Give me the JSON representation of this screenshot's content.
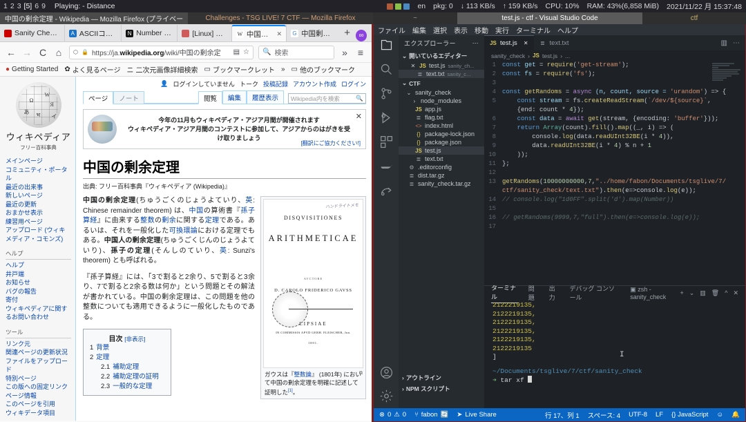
{
  "wm_bar": {
    "workspaces": [
      "1",
      "2",
      "3",
      "[5]",
      "6",
      "9"
    ],
    "active_workspace": "[5]",
    "playing": "Playing: - Distance",
    "keyboard_layout": "en",
    "pkg": "pkg: 0",
    "download": "↓ 113 KB/s",
    "upload": "↑ 159 KB/s",
    "cpu": "CPU: 10%",
    "ram": "RAM: 43%(6,858 MiB)",
    "clock": "2021/11/22 月 15:37:48"
  },
  "window_titles": {
    "firefox_private": "中国の剰余定理 - Wikipedia — Mozilla Firefox (プライベー",
    "firefox_ctf": "Challenges - TSG LIVE! 7 CTF — Mozilla Firefox",
    "middle": "~",
    "vscode": "test.js - ctf - Visual Studio Code",
    "ctf": "ctf"
  },
  "firefox": {
    "tabs": [
      {
        "label": "Sanity Checker",
        "icon": "",
        "icon_color": "#cc0000",
        "active": false
      },
      {
        "label": "ASCIIコード",
        "icon": "A",
        "icon_color": "#1a73c8",
        "active": false
      },
      {
        "label": "Number - Ja",
        "icon": "N",
        "icon_color": "#111111",
        "active": false
      },
      {
        "label": "[Linux] バイ",
        "icon": "T",
        "icon_color": "#d05a5a",
        "active": false
      },
      {
        "label": "中国の剰",
        "icon": "W",
        "icon_color": "#ffffff",
        "active": true
      },
      {
        "label": "中国剰余定",
        "icon": "G",
        "icon_color": "#4285f4",
        "active": false
      }
    ],
    "new_tab_label": "+",
    "pocket_label": "∞",
    "nav": {
      "back": "←",
      "forward": "→",
      "reload": "C",
      "home": "⌂",
      "shield": "🛡",
      "lock": "🔒",
      "url_prefix": "https://ja.",
      "url_domain": "wikipedia.org",
      "url_path": "/wiki/中国の剰余定",
      "reader_icon": "▤",
      "bookmark_icon": "☆",
      "search_placeholder": "検索",
      "overflow": "»",
      "menu": "≡"
    },
    "bookmarks": [
      {
        "label": "Getting Started",
        "icon": "●"
      },
      {
        "label": "よく見るページ",
        "icon": "✿"
      },
      {
        "label": "二次元画像詳細検索",
        "icon": "ニ"
      },
      {
        "label": "ブックマークレット",
        "icon": "▭"
      },
      {
        "label": "»",
        "icon": ""
      },
      {
        "label": "他のブックマーク",
        "icon": "▭"
      }
    ]
  },
  "wikipedia": {
    "wordmark": "ウィキペディア",
    "tagline": "フリー百科事典",
    "sidebar_sections": [
      {
        "heading": "",
        "links": [
          "メインページ",
          "コミュニティ・ポータル",
          "最近の出来事",
          "新しいページ",
          "最近の更新",
          "おまかせ表示",
          "練習用ページ",
          "アップロード (ウィキメディア・コモンズ)"
        ]
      },
      {
        "heading": "ヘルプ",
        "links": [
          "ヘルプ",
          "井戸端",
          "お知らせ",
          "バグの報告",
          "寄付",
          "ウィキペディアに関するお問い合わせ"
        ]
      },
      {
        "heading": "ツール",
        "links": [
          "リンク元",
          "関連ページの更新状況",
          "ファイルをアップロード",
          "特別ページ",
          "この版への固定リンク",
          "ページ情報",
          "このページを引用",
          "ウィキデータ項目"
        ]
      }
    ],
    "userbar": {
      "not_logged_in": "ログインしていません",
      "items": [
        "トーク",
        "投稿記録",
        "アカウント作成",
        "ログイン"
      ]
    },
    "page_tabs": [
      "ページ",
      "ノート"
    ],
    "view_tabs": [
      "閲覧",
      "編集",
      "履歴表示"
    ],
    "search_placeholder": "Wikipedia内を検索",
    "banner": {
      "line1": "今年の11月もウィキペディア・アジア月間が開催されます",
      "line2": "ウィキペディア・アジア月間のコンテストに参加して、アジアからのはがきを受け取りましょう",
      "translate": "[翻訳にご協力ください!]",
      "close": "✕"
    },
    "title": "中国の剰余定理",
    "subtitle": "出典: フリー百科事典『ウィキペディア (Wikipedia)』",
    "paragraph1_parts": [
      {
        "t": "中国の剰余定理",
        "s": "bld"
      },
      {
        "t": "(ちゅうごくのじょうよていり、",
        "s": ""
      },
      {
        "t": "英",
        "s": "lnk"
      },
      {
        "t": ": Chinese remainder theorem) は、",
        "s": ""
      },
      {
        "t": "中国",
        "s": "lnk"
      },
      {
        "t": "の算術書『",
        "s": ""
      },
      {
        "t": "孫子算経",
        "s": "lnk"
      },
      {
        "t": "』に由来する",
        "s": ""
      },
      {
        "t": "整数",
        "s": "lnk"
      },
      {
        "t": "の",
        "s": ""
      },
      {
        "t": "剰余",
        "s": "lnk"
      },
      {
        "t": "に関する",
        "s": ""
      },
      {
        "t": "定理",
        "s": "lnk"
      },
      {
        "t": "である。あるいは、それを一般化した",
        "s": ""
      },
      {
        "t": "可換環論",
        "s": "lnk"
      },
      {
        "t": "における定理でもある。",
        "s": ""
      },
      {
        "t": "中国人の剰余定理",
        "s": "bld"
      },
      {
        "t": "(ちゅうごくじんのじょうよていり)、",
        "s": ""
      },
      {
        "t": "孫子の定理",
        "s": "bld"
      },
      {
        "t": "(そんしのていり、",
        "s": ""
      },
      {
        "t": "英",
        "s": "lnk"
      },
      {
        "t": ": Sunzi's theorem) とも呼ばれる。",
        "s": ""
      }
    ],
    "paragraph2": "『孫子算経』には、「3で割ると2余り、5で割ると3余り、7で割ると2余る数は何か」という問題とその解法が書かれている。中国の剰余定理は、この問題を他の整数についても適用できるように一般化したものである。",
    "toc": {
      "heading": "目次",
      "toggle": "[非表示]",
      "items": [
        {
          "num": "1",
          "label": "背景",
          "level": 1
        },
        {
          "num": "2",
          "label": "定理",
          "level": 1
        },
        {
          "num": "2.1",
          "label": "補助定理",
          "level": 2
        },
        {
          "num": "2.2",
          "label": "補助定理の証明",
          "level": 2
        },
        {
          "num": "2.3",
          "label": "一般的な定理",
          "level": 2
        }
      ]
    },
    "figure": {
      "hand_note": "ハンドライトメモ",
      "title_line1": "DISQVISITIONES",
      "title_line2": "ARITHMETICAE",
      "auctore": "AVCTORE",
      "author": "D. CAROLO FRIDERICO GAVSS",
      "city": "LIPSIAE",
      "imprint": "IN COMMISSIS APVD GERH. FLEISCHER, Jun.",
      "year": "1801.",
      "caption_pre": "ガウスは『",
      "caption_link": "整数論",
      "caption_post": "』 (1801年) において中国の剰余定理を明確に記述して証明した",
      "caption_ref": "[1]",
      "caption_end": "。",
      "enlarge": "⧉"
    }
  },
  "vscode": {
    "menu": [
      "ファイル",
      "編集",
      "選択",
      "表示",
      "移動",
      "実行",
      "ターミナル",
      "ヘルプ"
    ],
    "activity_icons": [
      "explorer-icon",
      "search-icon",
      "source-control-icon",
      "run-debug-icon",
      "extensions-icon",
      "docker-icon",
      "live-share-icon"
    ],
    "activity_bottom_icons": [
      "account-icon",
      "settings-gear-icon"
    ],
    "sidebar": {
      "title": "エクスプローラー",
      "more": "⋯",
      "open_editors": {
        "label": "開いているエディター",
        "items": [
          {
            "name": "test.js",
            "desc": "sanity_ch...",
            "icon": "js",
            "close": "✕",
            "selected": false
          },
          {
            "name": "text.txt",
            "desc": "sanity_c...",
            "icon": "txt",
            "close": "",
            "selected": true
          }
        ]
      },
      "workspace": {
        "label": "CTF",
        "items": [
          {
            "name": "sanity_check",
            "icon": "folder",
            "indent": 1,
            "chevron": "⌄",
            "selected": false
          },
          {
            "name": "node_modules",
            "icon": "folder",
            "indent": 2,
            "chevron": "›",
            "selected": false
          },
          {
            "name": "app.js",
            "icon": "js",
            "indent": 2,
            "chevron": "",
            "selected": false
          },
          {
            "name": "flag.txt",
            "icon": "txt",
            "indent": 2,
            "chevron": "",
            "selected": false
          },
          {
            "name": "index.html",
            "icon": "html",
            "indent": 2,
            "chevron": "",
            "selected": false
          },
          {
            "name": "package-lock.json",
            "icon": "json",
            "indent": 2,
            "chevron": "",
            "selected": false
          },
          {
            "name": "package.json",
            "icon": "json",
            "indent": 2,
            "chevron": "",
            "selected": false
          },
          {
            "name": "test.js",
            "icon": "js",
            "indent": 2,
            "chevron": "",
            "selected": true
          },
          {
            "name": "text.txt",
            "icon": "txt",
            "indent": 2,
            "chevron": "",
            "selected": false
          },
          {
            "name": ".editorconfig",
            "icon": "gear",
            "indent": 1,
            "chevron": "",
            "selected": false
          },
          {
            "name": "dist.tar.gz",
            "icon": "txt",
            "indent": 1,
            "chevron": "",
            "selected": false
          },
          {
            "name": "sanity_check.tar.gz",
            "icon": "txt",
            "indent": 1,
            "chevron": "",
            "selected": false
          }
        ]
      },
      "outline_label": "アウトライン",
      "npm_label": "NPM スクリプト"
    },
    "editor_tabs": [
      {
        "label": "test.js",
        "icon": "js",
        "active": true,
        "close": "✕"
      },
      {
        "label": "text.txt",
        "icon": "txt",
        "active": false,
        "close": ""
      }
    ],
    "editor_actions": [
      "split-editor-icon",
      "more-actions-icon"
    ],
    "breadcrumb": [
      "sanity_check",
      "test.js",
      "..."
    ],
    "code_lines": [
      {
        "n": "1",
        "tokens": [
          {
            "t": "const ",
            "s": "k"
          },
          {
            "t": "get ",
            "s": "var"
          },
          {
            "t": "= ",
            "s": "pl"
          },
          {
            "t": "require",
            "s": "fn"
          },
          {
            "t": "(",
            "s": "pl"
          },
          {
            "t": "'get-stream'",
            "s": "str"
          },
          {
            "t": ");",
            "s": "pl"
          }
        ]
      },
      {
        "n": "2",
        "tokens": [
          {
            "t": "const ",
            "s": "k"
          },
          {
            "t": "fs ",
            "s": "var"
          },
          {
            "t": "= ",
            "s": "pl"
          },
          {
            "t": "require",
            "s": "fn"
          },
          {
            "t": "(",
            "s": "pl"
          },
          {
            "t": "'fs'",
            "s": "str"
          },
          {
            "t": ");",
            "s": "pl"
          }
        ]
      },
      {
        "n": "3",
        "tokens": []
      },
      {
        "n": "4",
        "tokens": [
          {
            "t": "const ",
            "s": "k"
          },
          {
            "t": "getRandoms ",
            "s": "fn"
          },
          {
            "t": "= ",
            "s": "pl"
          },
          {
            "t": "async ",
            "s": "kw2"
          },
          {
            "t": "(n, count, source = ",
            "s": "var"
          },
          {
            "t": "'urandom'",
            "s": "str"
          },
          {
            "t": ") => {",
            "s": "pl"
          }
        ]
      },
      {
        "n": "5",
        "tokens": [
          {
            "t": "    const ",
            "s": "k"
          },
          {
            "t": "stream ",
            "s": "var"
          },
          {
            "t": "= fs.",
            "s": "pl"
          },
          {
            "t": "createReadStream",
            "s": "fn"
          },
          {
            "t": "(",
            "s": "pl"
          },
          {
            "t": "`/dev/${source}`",
            "s": "str"
          },
          {
            "t": ",",
            "s": "pl"
          }
        ]
      },
      {
        "n": "",
        "tokens": [
          {
            "t": "    {end: count * ",
            "s": "pl"
          },
          {
            "t": "4",
            "s": "num"
          },
          {
            "t": "});",
            "s": "pl"
          }
        ]
      },
      {
        "n": "6",
        "tokens": [
          {
            "t": "    const ",
            "s": "k"
          },
          {
            "t": "data ",
            "s": "var"
          },
          {
            "t": "= ",
            "s": "pl"
          },
          {
            "t": "await ",
            "s": "kw2"
          },
          {
            "t": "get",
            "s": "fn"
          },
          {
            "t": "(stream, {encoding: ",
            "s": "pl"
          },
          {
            "t": "'buffer'",
            "s": "str"
          },
          {
            "t": "}));",
            "s": "pl"
          }
        ]
      },
      {
        "n": "7",
        "tokens": [
          {
            "t": "    return ",
            "s": "k"
          },
          {
            "t": "Array",
            "s": "cls"
          },
          {
            "t": "(count).",
            "s": "pl"
          },
          {
            "t": "fill",
            "s": "fn"
          },
          {
            "t": "().",
            "s": "pl"
          },
          {
            "t": "map",
            "s": "fn"
          },
          {
            "t": "((_, i) => (",
            "s": "pl"
          }
        ]
      },
      {
        "n": "8",
        "tokens": [
          {
            "t": "        console.",
            "s": "pl"
          },
          {
            "t": "log",
            "s": "fn"
          },
          {
            "t": "(data.",
            "s": "pl"
          },
          {
            "t": "readUInt32BE",
            "s": "fn"
          },
          {
            "t": "(i * ",
            "s": "pl"
          },
          {
            "t": "4",
            "s": "num"
          },
          {
            "t": ")),",
            "s": "pl"
          }
        ]
      },
      {
        "n": "9",
        "tokens": [
          {
            "t": "        data.",
            "s": "pl"
          },
          {
            "t": "readUInt32BE",
            "s": "fn"
          },
          {
            "t": "(i * ",
            "s": "pl"
          },
          {
            "t": "4",
            "s": "num"
          },
          {
            "t": ") % n + ",
            "s": "pl"
          },
          {
            "t": "1",
            "s": "num"
          }
        ]
      },
      {
        "n": "10",
        "tokens": [
          {
            "t": "    ));",
            "s": "pl"
          }
        ]
      },
      {
        "n": "11",
        "tokens": [
          {
            "t": "};",
            "s": "pl"
          }
        ]
      },
      {
        "n": "12",
        "tokens": []
      },
      {
        "n": "13",
        "tokens": [
          {
            "t": "getRandoms",
            "s": "fn"
          },
          {
            "t": "(",
            "s": "pl"
          },
          {
            "t": "10000000000",
            "s": "num"
          },
          {
            "t": ",",
            "s": "pl"
          },
          {
            "t": "7",
            "s": "num"
          },
          {
            "t": ",",
            "s": "pl"
          },
          {
            "t": "\"../home/fabon/Documents/tsglive/7/",
            "s": "str"
          }
        ]
      },
      {
        "n": "",
        "tokens": [
          {
            "t": "ctf/sanity_check/text.txt\"",
            "s": "str"
          },
          {
            "t": ").",
            "s": "pl"
          },
          {
            "t": "then",
            "s": "fn"
          },
          {
            "t": "(e=>console.",
            "s": "pl"
          },
          {
            "t": "log",
            "s": "fn"
          },
          {
            "t": "(e));",
            "s": "pl"
          }
        ]
      },
      {
        "n": "14",
        "tokens": [
          {
            "t": "// console.log(\"1d0FF\".split('d').map(Number))",
            "s": "cmt"
          }
        ]
      },
      {
        "n": "15",
        "tokens": []
      },
      {
        "n": "16",
        "tokens": [
          {
            "t": "// getRandoms(9999,7,\"full\").then(e=>console.log(e));",
            "s": "cmt"
          }
        ]
      },
      {
        "n": "17",
        "tokens": []
      }
    ],
    "panel": {
      "tabs": [
        "ターミナル",
        "問題",
        "出力",
        "デバッグ コンソール"
      ],
      "active_tab": "ターミナル",
      "shell_selector": "zsh - sanity_check",
      "actions": [
        "+",
        "⌄",
        "split-terminal-icon",
        "trash-icon",
        "^",
        "✕"
      ],
      "terminal_output": [
        "2122219135,",
        "2122219135,",
        "2122219135,",
        "2122219135,",
        "2122219135,",
        "2122219135"
      ],
      "terminal_close_bracket": "]",
      "terminal_path": "~/Documents/tsglive/7/ctf/sanity_check",
      "terminal_prompt": "➜",
      "terminal_command": "tar xf "
    },
    "status_bar": {
      "errors": "0",
      "warnings": "0",
      "branch": "fabon",
      "live_share": "Live Share",
      "line_col": "行 17、列 1",
      "spaces": "スペース: 4",
      "encoding": "UTF-8",
      "eol": "LF",
      "language": "JavaScript",
      "feedback_icon": "smiley-icon",
      "bell_icon": "bell-icon"
    }
  }
}
